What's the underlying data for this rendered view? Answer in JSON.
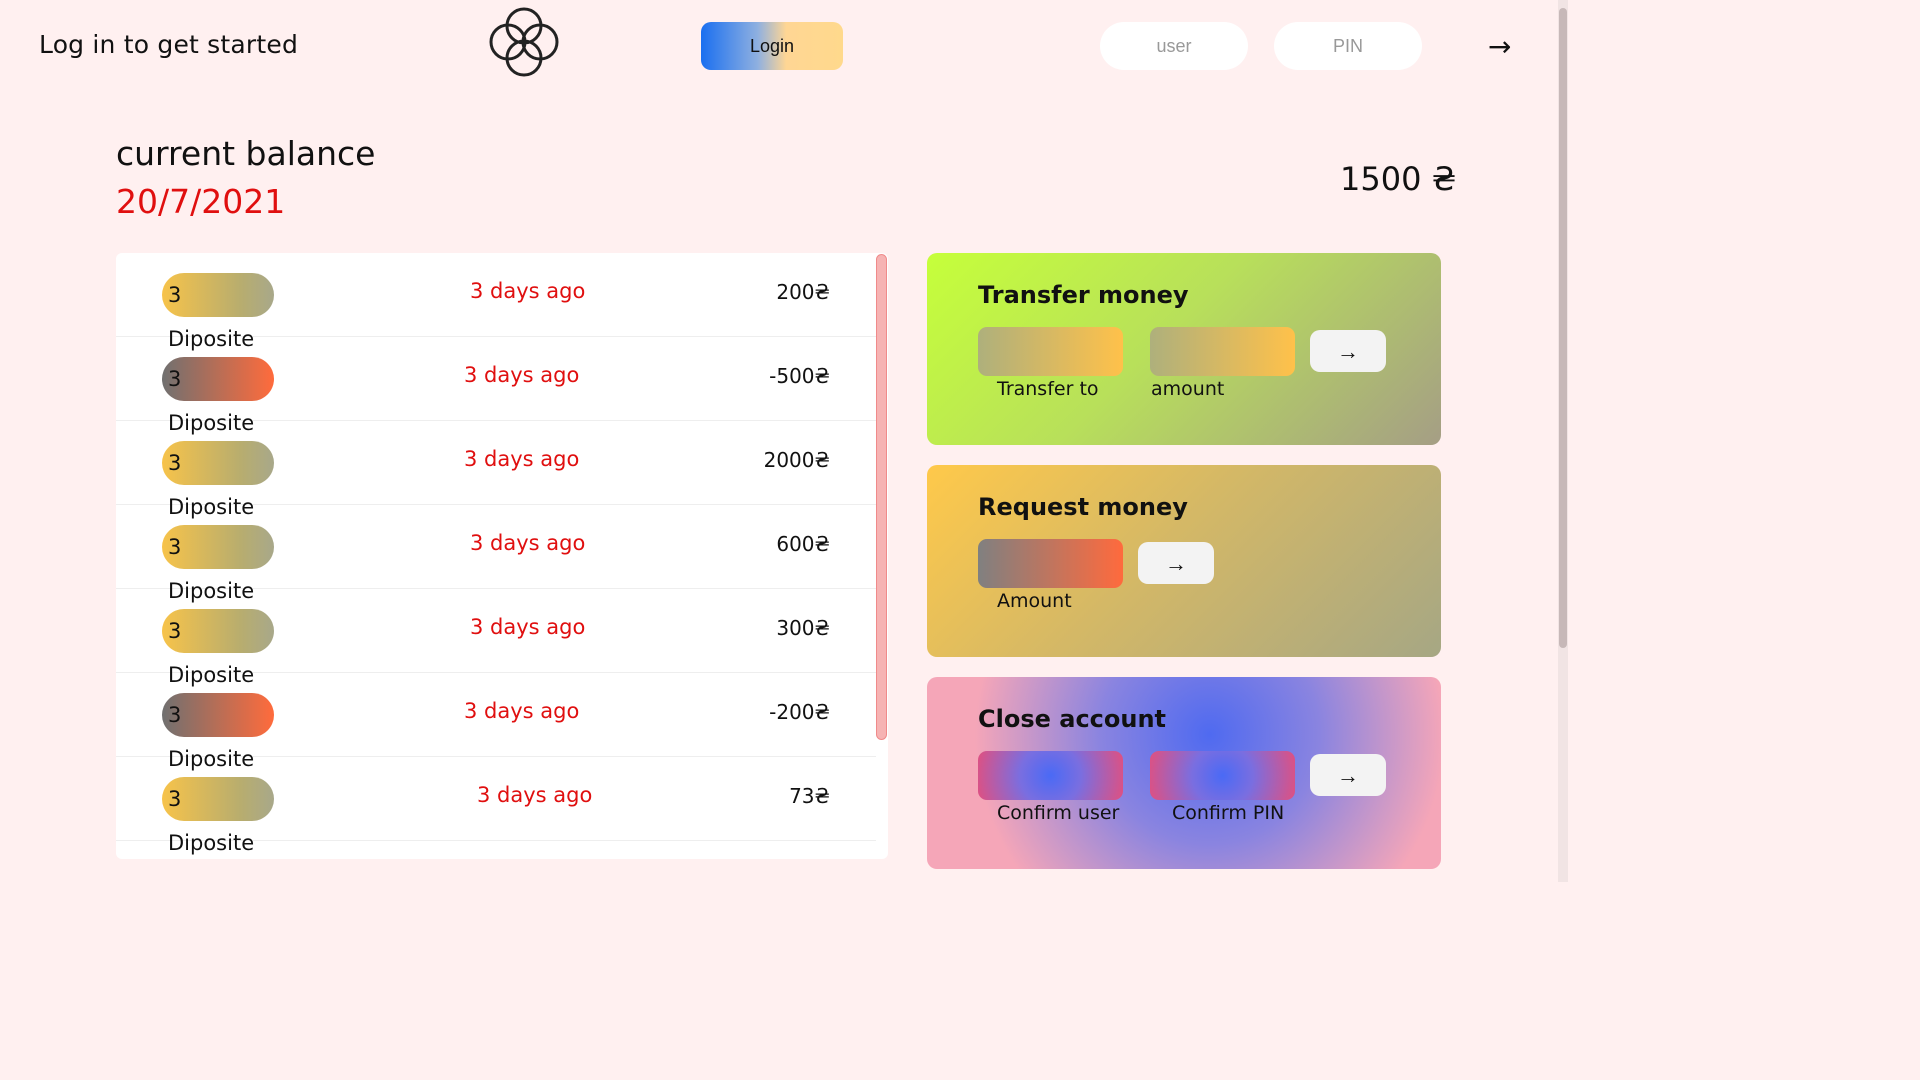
{
  "header": {
    "welcome": "Log in to get started",
    "login_label": "Login",
    "user_placeholder": "user",
    "pin_placeholder": "PIN",
    "go_arrow": "→"
  },
  "balance": {
    "label": "current balance",
    "date": "20/7/2021",
    "value": "1500 ₴"
  },
  "movements": [
    {
      "type": "3 Diposite",
      "kind": "deposit",
      "date": "3 days ago",
      "amount": "200₴"
    },
    {
      "type": "3 Diposite",
      "kind": "withdrawal",
      "date": "3 days ago",
      "amount": "-500₴"
    },
    {
      "type": "3 Diposite",
      "kind": "deposit",
      "date": "3 days ago",
      "amount": "2000₴"
    },
    {
      "type": "3 Diposite",
      "kind": "deposit",
      "date": "3 days ago",
      "amount": "600₴"
    },
    {
      "type": "3 Diposite",
      "kind": "deposit",
      "date": "3 days ago",
      "amount": "300₴"
    },
    {
      "type": "3 Diposite",
      "kind": "withdrawal",
      "date": "3 days ago",
      "amount": "-200₴"
    },
    {
      "type": "3 Diposite",
      "kind": "deposit",
      "date": "3 days ago",
      "amount": "73₴"
    }
  ],
  "operations": {
    "transfer": {
      "title": "Transfer money",
      "to_label": "Transfer to",
      "amount_label": "amount",
      "submit": "→"
    },
    "request": {
      "title": "Request money",
      "amount_label": "Amount",
      "submit": "→"
    },
    "close": {
      "title": "Close account",
      "user_label": "Confirm user",
      "pin_label": "Confirm PIN",
      "submit": "→"
    }
  },
  "colors": {
    "background": "#fff0f0",
    "date_red": "#e00f0f",
    "transfer_panel": "#c6ff3a",
    "request_panel": "#ffc94a",
    "close_panel": "#4f6af0"
  }
}
